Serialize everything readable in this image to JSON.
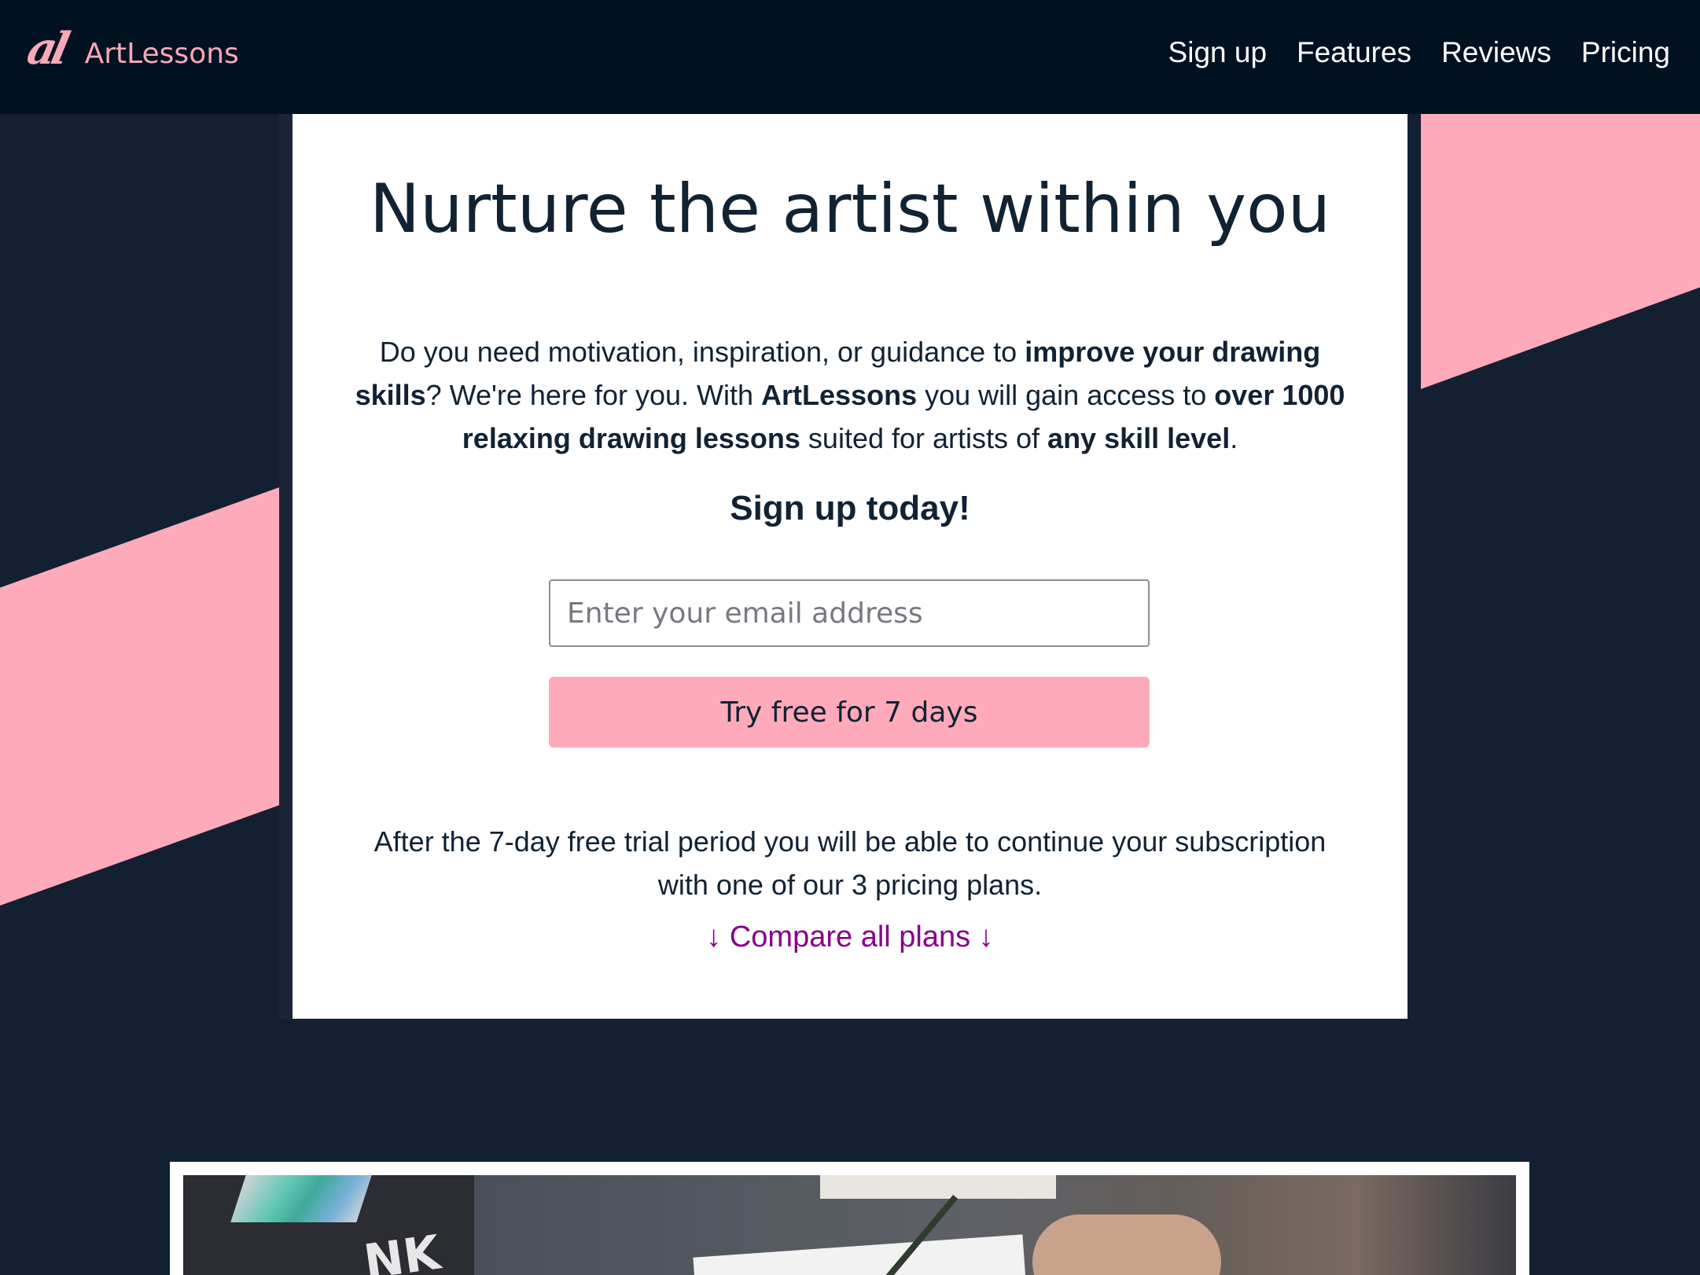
{
  "brand": {
    "logo_mark": "al",
    "name": "ArtLessons"
  },
  "nav": {
    "items": [
      "Sign up",
      "Features",
      "Reviews",
      "Pricing"
    ]
  },
  "hero": {
    "title": "Nurture the artist within you",
    "intro": {
      "p1": "Do you need motivation, inspiration, or guidance to ",
      "b1": "improve your drawing skills",
      "p2": "? We're here for you. With ",
      "b2": "ArtLessons",
      "p3": " you will gain access to ",
      "b3": "over 1000 relaxing drawing lessons",
      "p4": " suited for artists of ",
      "b4": "any skill level",
      "p5": "."
    },
    "signup_heading": "Sign up today!",
    "email_placeholder": "Enter your email address",
    "email_value": "",
    "button_label": "Try free for 7 days",
    "trial_note": "After the 7-day free trial period you will be able to continue your subscription with one of our 3 pricing plans.",
    "compare_link": "↓ Compare all plans ↓"
  },
  "image": {
    "label_text": "NK"
  },
  "colors": {
    "background": "#122032",
    "navbar": "#001122",
    "accent": "#ffaabb",
    "link": "#880088",
    "text": "#112233"
  }
}
